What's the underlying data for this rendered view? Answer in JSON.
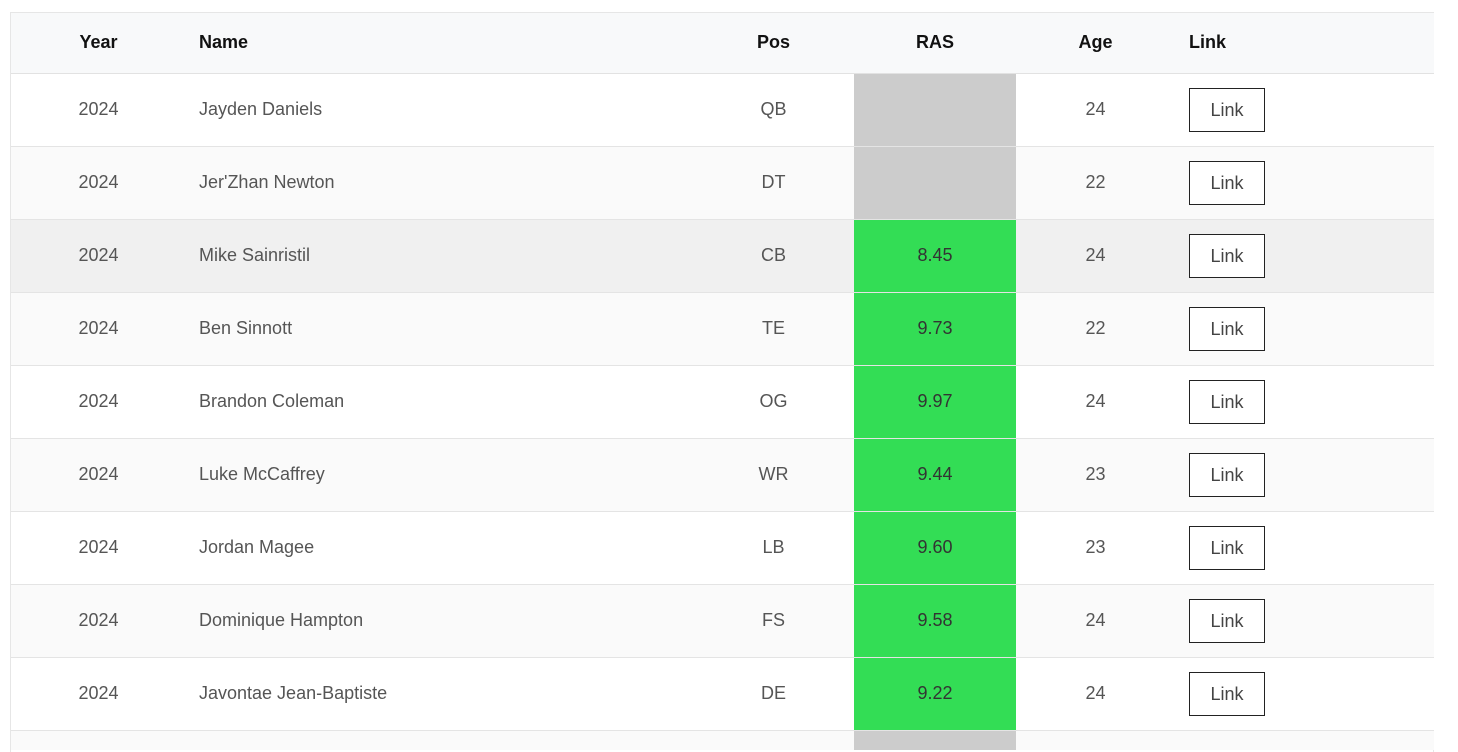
{
  "table": {
    "headers": {
      "year": "Year",
      "name": "Name",
      "pos": "Pos",
      "ras": "RAS",
      "age": "Age",
      "link": "Link"
    },
    "rows": [
      {
        "year": "2024",
        "name": "Jayden Daniels",
        "pos": "QB",
        "ras": "",
        "ras_color": "#cccccc",
        "age": "24",
        "link": "Link"
      },
      {
        "year": "2024",
        "name": "Jer'Zhan Newton",
        "pos": "DT",
        "ras": "",
        "ras_color": "#cccccc",
        "age": "22",
        "link": "Link"
      },
      {
        "year": "2024",
        "name": "Mike Sainristil",
        "pos": "CB",
        "ras": "8.45",
        "ras_color": "#33dd55",
        "age": "24",
        "link": "Link"
      },
      {
        "year": "2024",
        "name": "Ben Sinnott",
        "pos": "TE",
        "ras": "9.73",
        "ras_color": "#33dd55",
        "age": "22",
        "link": "Link"
      },
      {
        "year": "2024",
        "name": "Brandon Coleman",
        "pos": "OG",
        "ras": "9.97",
        "ras_color": "#33dd55",
        "age": "24",
        "link": "Link"
      },
      {
        "year": "2024",
        "name": "Luke McCaffrey",
        "pos": "WR",
        "ras": "9.44",
        "ras_color": "#33dd55",
        "age": "23",
        "link": "Link"
      },
      {
        "year": "2024",
        "name": "Jordan Magee",
        "pos": "LB",
        "ras": "9.60",
        "ras_color": "#33dd55",
        "age": "23",
        "link": "Link"
      },
      {
        "year": "2024",
        "name": "Dominique Hampton",
        "pos": "FS",
        "ras": "9.58",
        "ras_color": "#33dd55",
        "age": "24",
        "link": "Link"
      },
      {
        "year": "2024",
        "name": "Javontae Jean-Baptiste",
        "pos": "DE",
        "ras": "9.22",
        "ras_color": "#33dd55",
        "age": "24",
        "link": "Link"
      }
    ],
    "partial_row": {
      "ras_color": "#cccccc"
    }
  }
}
